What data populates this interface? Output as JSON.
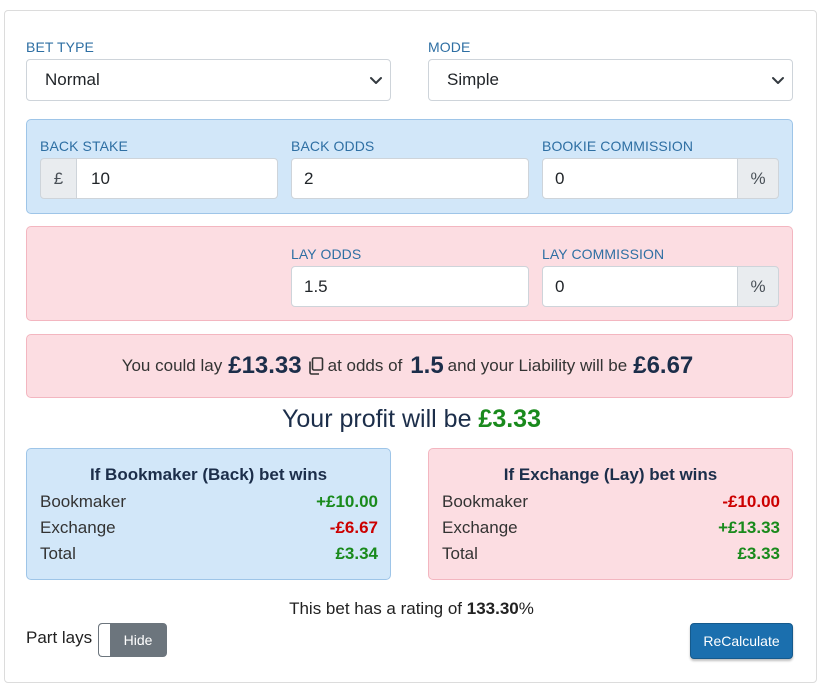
{
  "bet_type": {
    "label": "BET TYPE",
    "value": "Normal"
  },
  "mode": {
    "label": "MODE",
    "value": "Simple"
  },
  "back": {
    "stake_label": "BACK STAKE",
    "currency": "£",
    "stake": "10",
    "odds_label": "BACK ODDS",
    "odds": "2",
    "commission_label": "BOOKIE COMMISSION",
    "commission": "0",
    "percent": "%"
  },
  "lay": {
    "odds_label": "LAY ODDS",
    "odds": "1.5",
    "commission_label": "LAY COMMISSION",
    "commission": "0",
    "percent": "%"
  },
  "result": {
    "prefix": "You could lay",
    "lay_stake": "£13.33",
    "mid": "at odds of",
    "odds": "1.5",
    "suffix": "and your Liability will be",
    "liability": "£6.67"
  },
  "profit": {
    "text": "Your profit will be",
    "amount": "£3.33"
  },
  "back_wins": {
    "title": "If Bookmaker (Back) bet wins",
    "rows": [
      {
        "label": "Bookmaker",
        "value": "+£10.00"
      },
      {
        "label": "Exchange",
        "value": "-£6.67"
      },
      {
        "label": "Total",
        "value": "£3.34"
      }
    ]
  },
  "lay_wins": {
    "title": "If Exchange (Lay) bet wins",
    "rows": [
      {
        "label": "Bookmaker",
        "value": "-£10.00"
      },
      {
        "label": "Exchange",
        "value": "+£13.33"
      },
      {
        "label": "Total",
        "value": "£3.33"
      }
    ]
  },
  "rating": {
    "prefix": "This bet has a rating of",
    "value": "133.30",
    "suffix": "%"
  },
  "part_lays": {
    "label": "Part lays",
    "toggle": "Hide"
  },
  "recalculate": "ReCalculate",
  "colors": {
    "positive": "#198a1c",
    "negative": "#cc0000",
    "back_panel": "#d2e7f9",
    "lay_panel": "#fcdde2",
    "button": "#1b6fae"
  },
  "icons": {
    "select_arrow": "chevron-down-icon",
    "copy": "copy-icon"
  }
}
